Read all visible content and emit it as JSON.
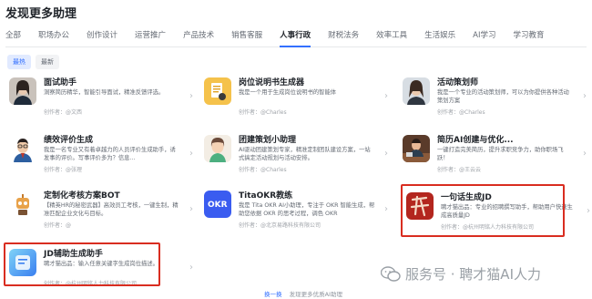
{
  "page": {
    "title": "发现更多助理"
  },
  "tabs": [
    {
      "label": "全部",
      "active": false
    },
    {
      "label": "职场办公",
      "active": false
    },
    {
      "label": "创作设计",
      "active": false
    },
    {
      "label": "运营推广",
      "active": false
    },
    {
      "label": "产品技术",
      "active": false
    },
    {
      "label": "销售客服",
      "active": false
    },
    {
      "label": "人事行政",
      "active": true
    },
    {
      "label": "财税法务",
      "active": false
    },
    {
      "label": "效率工具",
      "active": false
    },
    {
      "label": "生活娱乐",
      "active": false
    },
    {
      "label": "AI学习",
      "active": false
    },
    {
      "label": "学习教育",
      "active": false
    }
  ],
  "filters": [
    {
      "label": "最热",
      "active": true
    },
    {
      "label": "最新",
      "active": false
    }
  ],
  "cards": [
    {
      "title": "面试助手",
      "desc": "洞察简历精华，智能引导面试，精准反馈评选。",
      "author": "创作者：@文西"
    },
    {
      "title": "岗位说明书生成器",
      "desc": "我是一个用于生成岗位说明书的智能体",
      "author": "创作者：@Charles"
    },
    {
      "title": "活动策划师",
      "desc": "我是一个专业的活动策划师，可以为你提供各种活动策划方案",
      "author": "创作者：@Charles"
    },
    {
      "title": "绩效评价生成",
      "desc": "我是一名专业又有着卓越力的人员评价生成助手，诱发事的评价。写事评价多为？信息...",
      "author": "创作者：@张理"
    },
    {
      "title": "团建策划小助理",
      "desc": "AI驱动团建策划专家，精准定制团队建设方案，一站式搞定活动规划与活动安排。",
      "author": "创作者：@Charles"
    },
    {
      "title": "简历AI创建与优化...",
      "desc": "一键打造完美简历，提升求职竞争力，助你职场飞跃！",
      "author": "创作者：@王云云"
    },
    {
      "title": "定制化考核方案BOT",
      "desc": "【精英HR的秘密武器】高效员工考核，一键生制，精准匹配企业文化与目标。",
      "author": "创作者：@"
    },
    {
      "title": "TitaOKR教练",
      "desc": "我是 Tita OKR AI小助理，专注于 OKR 智能生成，帮助您依据 OKR 的思考过程，调色 OKR",
      "author": "创作者：@北京易路科技有限公司"
    },
    {
      "title": "一句话生成JD",
      "desc": "聘才猫出品：专业的招聘撰写助手，帮助用户快速生成高质量JD",
      "author": "创作者：@杭州明铭人力科技有限公司"
    },
    {
      "title": "JD辅助生成助手",
      "desc": "聘才猫出品：输入任意关键字生成岗位描述。",
      "author": "创作者：@杭州明铭人力科技有限公司"
    }
  ],
  "bottom": {
    "link": "换一换",
    "muted": "发现更多优质AI助理"
  },
  "watermark": {
    "text": "服务号 · 聘才猫AI人力"
  },
  "colors": {
    "accent": "#3370ff",
    "highlight": "#d92d20"
  }
}
